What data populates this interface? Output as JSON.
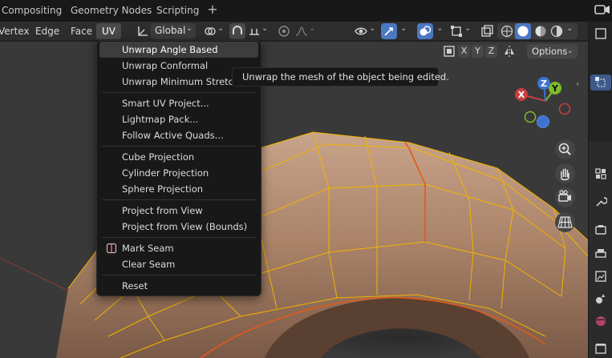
{
  "workspace_tabs": [
    "Compositing",
    "Geometry Nodes",
    "Scripting"
  ],
  "header": {
    "menus": [
      "Vertex",
      "Edge",
      "Face",
      "UV"
    ],
    "orientation": "Global"
  },
  "viewport": {
    "axes": [
      "X",
      "Y",
      "Z"
    ],
    "options_label": "Options",
    "gizmo": {
      "x": "X",
      "y": "Y",
      "z": "Z"
    }
  },
  "uv_menu": {
    "items": [
      "Unwrap Angle Based",
      "Unwrap Conformal",
      "Unwrap Minimum Stretch",
      "Smart UV Project...",
      "Lightmap Pack...",
      "Follow Active Quads...",
      "Cube Projection",
      "Cylinder Projection",
      "Sphere Projection",
      "Project from View",
      "Project from View (Bounds)",
      "Mark Seam",
      "Clear Seam",
      "Reset"
    ],
    "highlighted": "Unwrap Angle Based"
  },
  "tooltip": "Unwrap the mesh of the object being edited.",
  "colors": {
    "mesh_face": "#b08a6f",
    "mesh_edge": "#f0b400",
    "seam": "#e05a1a",
    "highlight": "#3d3d3d",
    "accent_blue": "#4a78c2"
  }
}
